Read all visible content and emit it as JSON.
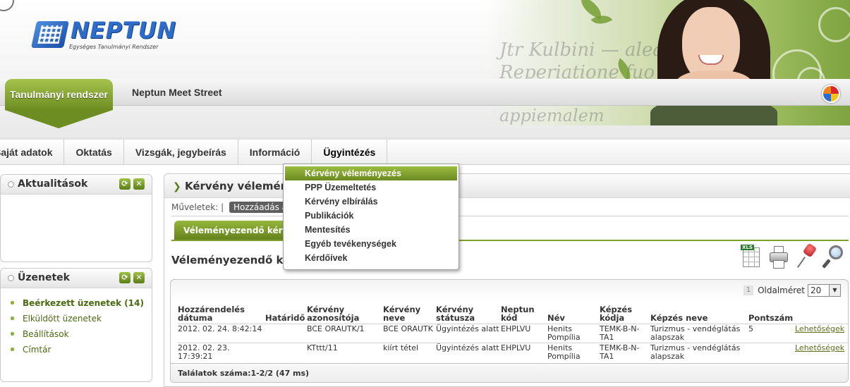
{
  "header": {
    "brand": "NEPTUN",
    "tagline": "Egységes Tanulmányi Rendszer",
    "tabs": [
      {
        "label": "Tanulmányi rendszer",
        "active": true
      },
      {
        "label": "Neptun Meet Street",
        "active": false
      }
    ]
  },
  "mainmenu": {
    "items": [
      {
        "label": "Saját adatok"
      },
      {
        "label": "Oktatás"
      },
      {
        "label": "Vizsgák, jegybeírás"
      },
      {
        "label": "Információ"
      },
      {
        "label": "Ügyintézés",
        "active": true
      }
    ]
  },
  "dropdown": {
    "items": [
      {
        "label": "Kérvény véleményezés",
        "highlighted": true
      },
      {
        "label": "PPP Üzemeltetés"
      },
      {
        "label": "Kérvény elbírálás"
      },
      {
        "label": "Publikációk"
      },
      {
        "label": "Mentesítés"
      },
      {
        "label": "Egyéb tevékenységek"
      },
      {
        "label": "Kérdőívek"
      }
    ]
  },
  "panels": {
    "news": {
      "title": "Aktualitások"
    },
    "messages": {
      "title": "Üzenetek",
      "items": [
        {
          "label": "Beérkezett üzenetek (14)",
          "bold": true
        },
        {
          "label": "Elküldött üzenetek"
        },
        {
          "label": "Beállítások"
        },
        {
          "label": "Címtár"
        }
      ]
    }
  },
  "content": {
    "title": "Kérvény véleménye",
    "operations_label": "Műveletek:",
    "operations_sep": "|",
    "add_button": "Hozzáadás a",
    "subtab": "Véleményezendő kérvé",
    "list_title": "Véleményezendő kérvé",
    "tools": [
      "xls-export-icon",
      "print-icon",
      "pin-icon",
      "zoom-icon"
    ],
    "xls_tag": "XLS"
  },
  "grid": {
    "page_current": "1",
    "page_size_label": "Oldalméret",
    "page_size": "20",
    "columns": [
      "Hozzárendelés dátuma",
      "Határidő",
      "Kérvény azonosítója",
      "Kérvény neve",
      "Kérvény státusza",
      "Neptun kód",
      "Név",
      "Képzés kódja",
      "Képzés neve",
      "Pontszám",
      ""
    ],
    "rows": [
      [
        "2012. 02. 24. 8:42:14",
        "",
        "BCE ORAUTK/1",
        "BCE ORAUTK",
        "Ügyintézés alatt",
        "EHPLVU",
        "Henits Pompília",
        "TEMK-B-N-TA1",
        "Turizmus - vendéglátás alapszak",
        "5",
        "Lehetőségek"
      ],
      [
        "2012. 02. 23. 17:39:21",
        "",
        "KTttt/11",
        "kiírt tétel",
        "Ügyintézés alatt",
        "EHPLVU",
        "Henits Pompília",
        "TEMK-B-N-TA1",
        "Turizmus - vendéglátás alapszak",
        "",
        "Lehetőségek"
      ]
    ],
    "footer": "Találatok száma:1-2/2 (47 ms)"
  }
}
